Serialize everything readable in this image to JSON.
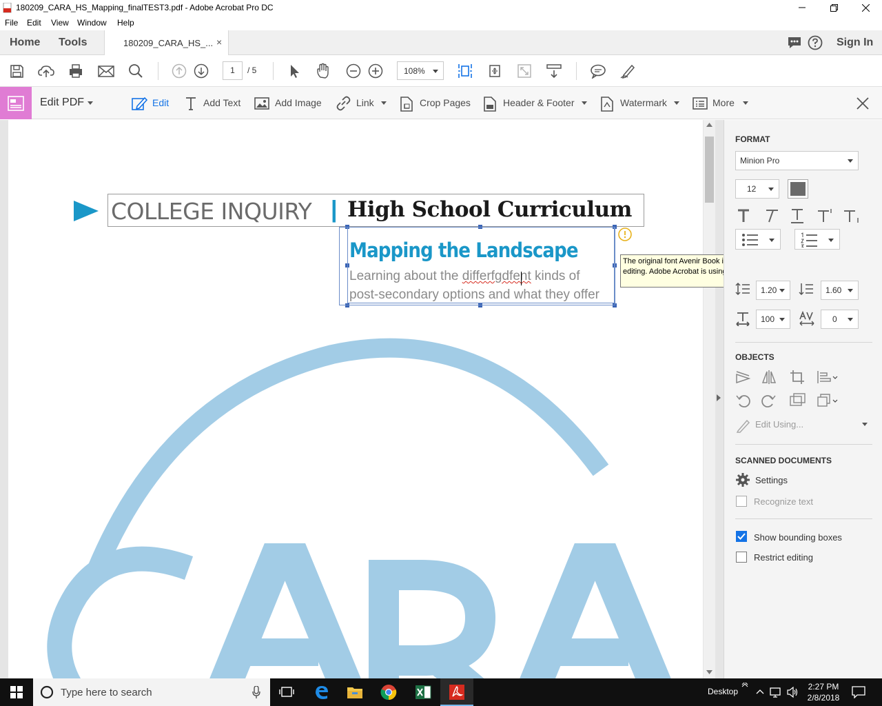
{
  "window": {
    "title": "180209_CARA_HS_Mapping_finalTEST3.pdf - Adobe Acrobat Pro DC"
  },
  "menu": [
    "File",
    "Edit",
    "View",
    "Window",
    "Help"
  ],
  "tabs": {
    "home": "Home",
    "tools": "Tools",
    "document": "180209_CARA_HS_...",
    "close_glyph": "×",
    "sign_in": "Sign In"
  },
  "toolbar": {
    "current_page": "1",
    "page_total": "/ 5",
    "zoom": "108%"
  },
  "edit_toolbar": {
    "title": "Edit PDF",
    "edit": "Edit",
    "add_text": "Add Text",
    "add_image": "Add Image",
    "link": "Link",
    "crop_pages": "Crop Pages",
    "header_footer": "Header & Footer",
    "watermark": "Watermark",
    "more": "More"
  },
  "document": {
    "header_left": "COLLEGE INQUIRY",
    "header_sep": "|",
    "header_right": "High School Curriculum",
    "heading": "Mapping the Landscape",
    "body_line1_pre": "Learning about the ",
    "body_line1_err": "differfgdfent",
    "body_line1_post": " kinds of",
    "body_line2": "post-secondary options and what they offer",
    "logo_text": "CARA",
    "colors": {
      "accent": "#1a97c8",
      "logo": "#a2cce6"
    }
  },
  "tooltip": {
    "text": "The original font Avenir Book is not available or can't be used in editing. Adobe Acrobat is using the font Minion Pro in its place."
  },
  "panel": {
    "format_heading": "FORMAT",
    "font": "Minion Pro",
    "font_size": "12",
    "line_spacing": "1.20",
    "para_spacing": "1.60",
    "h_scale": "100",
    "char_spacing": "0",
    "objects_heading": "OBJECTS",
    "edit_using": "Edit Using...",
    "scanned_heading": "SCANNED DOCUMENTS",
    "settings": "Settings",
    "recognize_text": "Recognize text",
    "show_bounding_boxes": "Show bounding boxes",
    "show_bounding_boxes_checked": true,
    "restrict_editing": "Restrict editing",
    "restrict_editing_checked": false
  },
  "taskbar": {
    "search_placeholder": "Type here to search",
    "desktop": "Desktop",
    "time": "2:27 PM",
    "date": "2/8/2018"
  }
}
